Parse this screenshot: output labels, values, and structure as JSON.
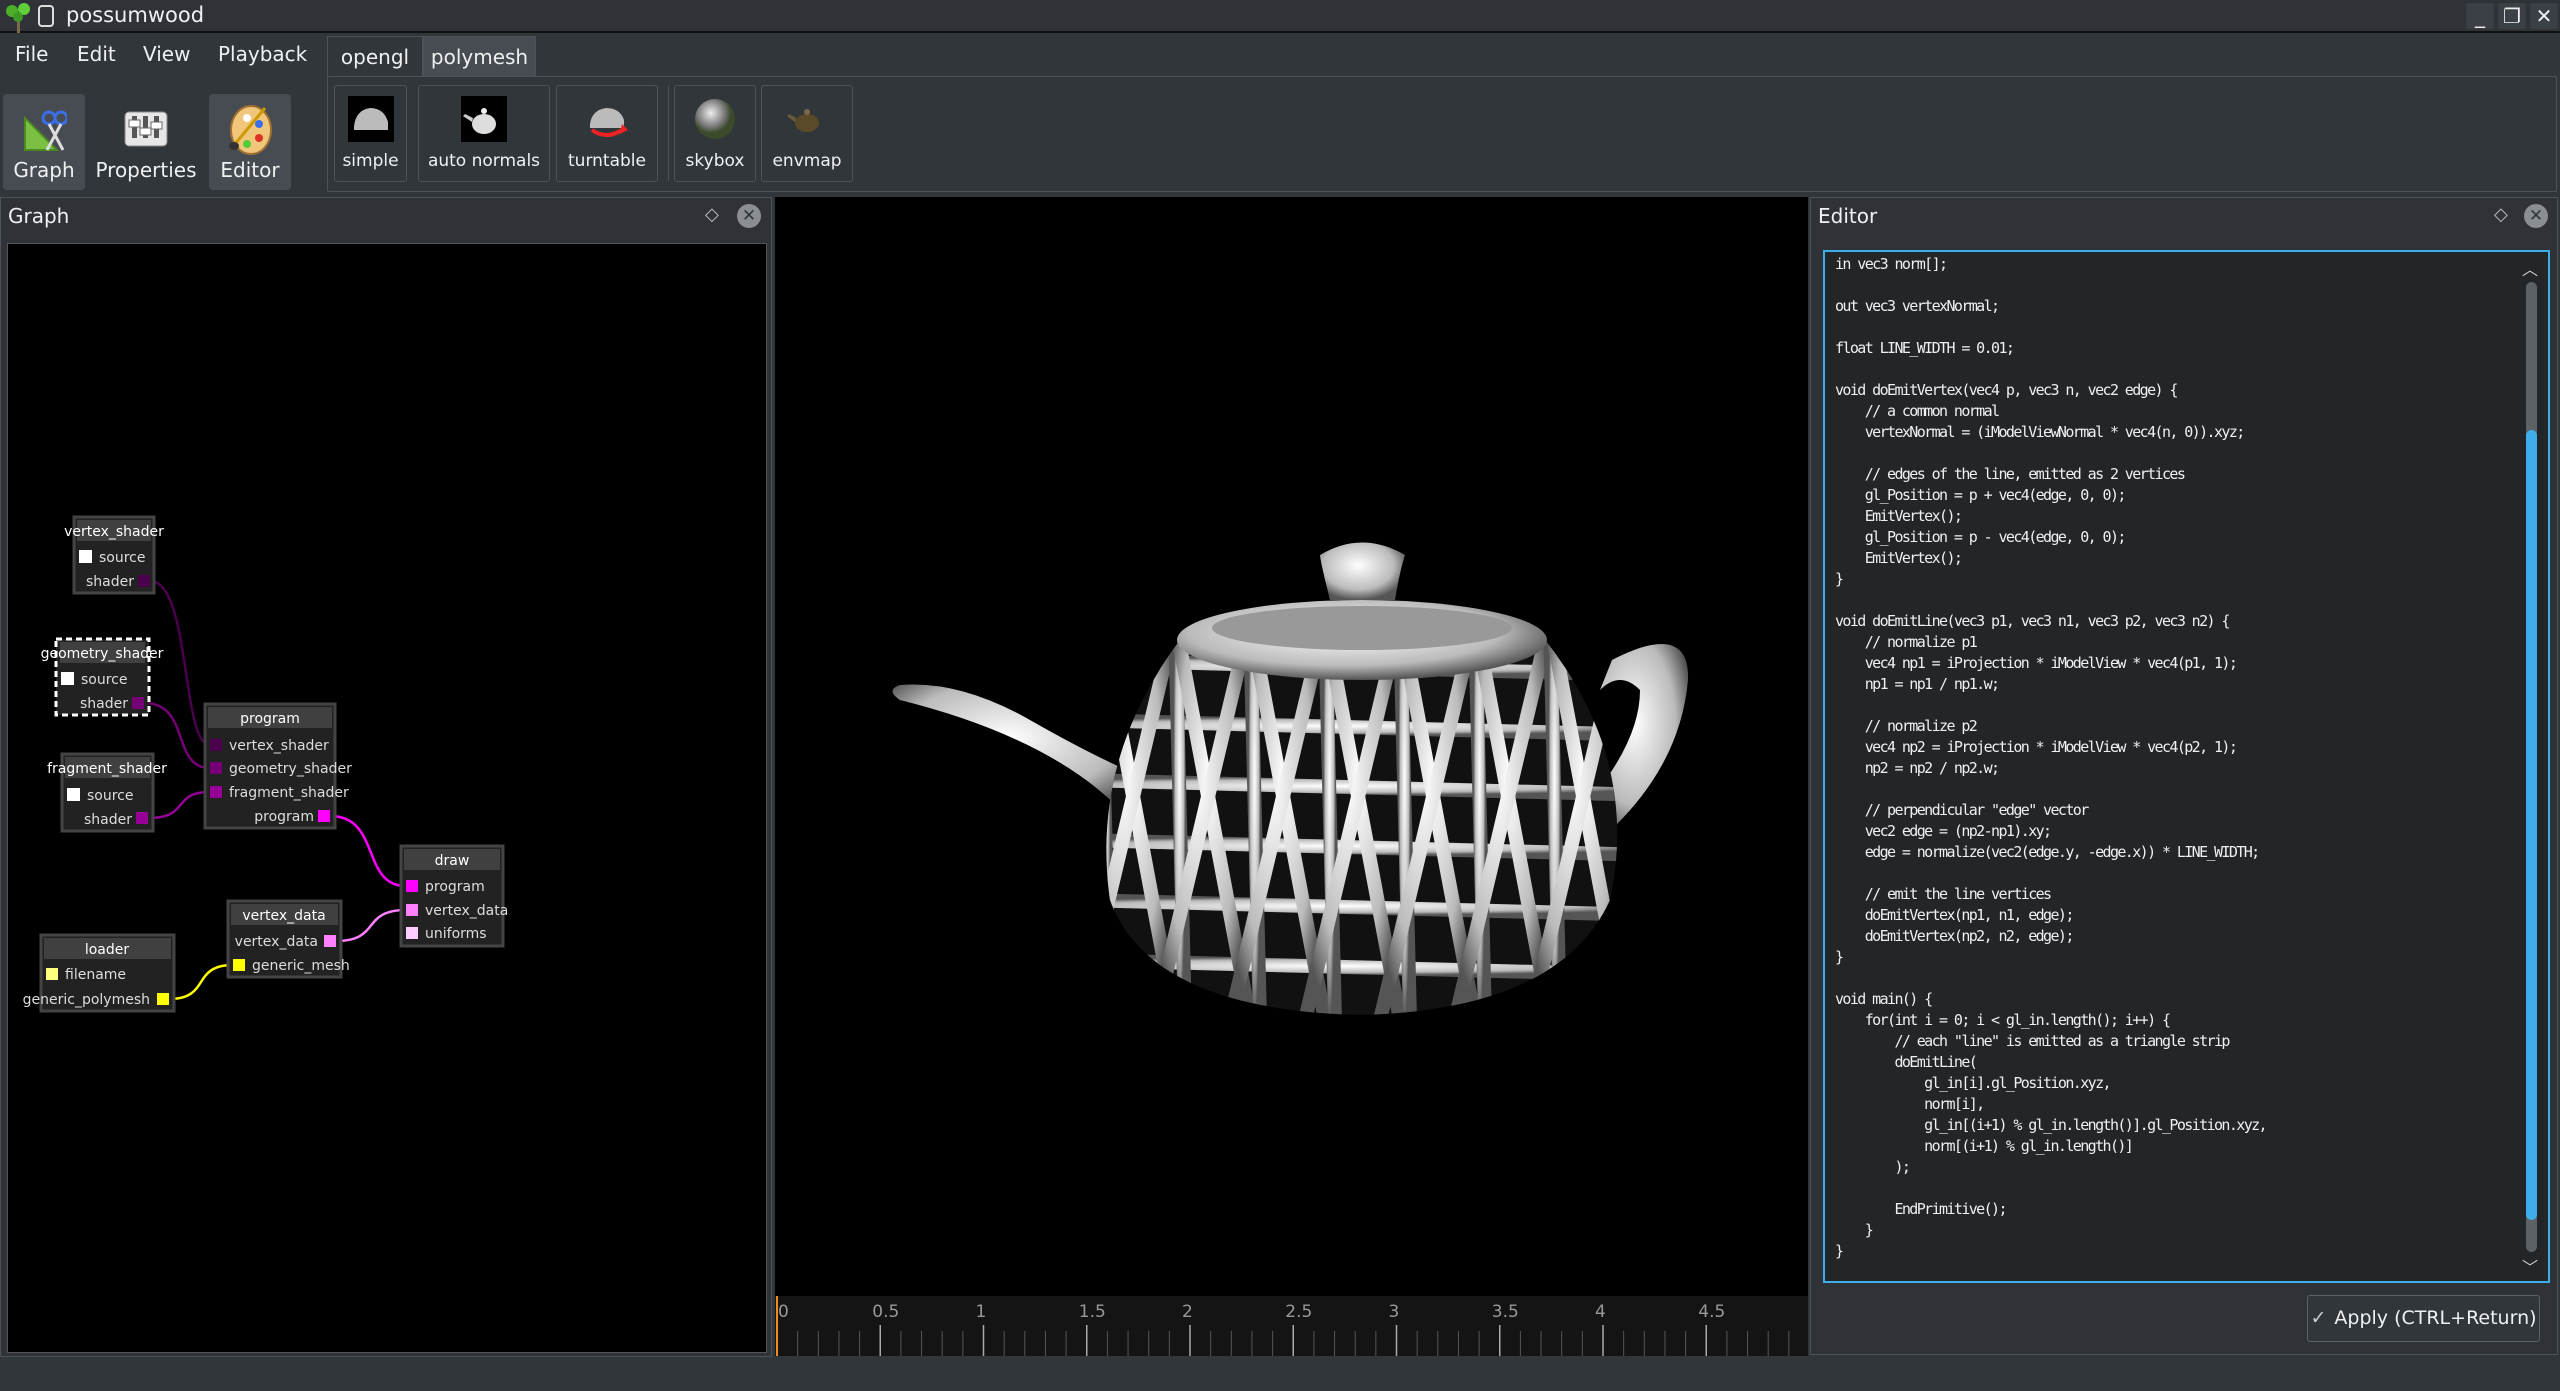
{
  "window": {
    "title": "possumwood",
    "controls": {
      "minimize": "_",
      "restore": "❐",
      "close": "✕"
    }
  },
  "menu": [
    "File",
    "Edit",
    "View",
    "Playback"
  ],
  "left_toolbar": [
    {
      "label": "Graph",
      "icon": "graph-tools-icon",
      "active": true
    },
    {
      "label": "Properties",
      "icon": "properties-sliders-icon",
      "active": false
    },
    {
      "label": "Editor",
      "icon": "palette-icon",
      "active": true
    }
  ],
  "tabs": [
    {
      "label": "opengl",
      "selected": false
    },
    {
      "label": "polymesh",
      "selected": true
    }
  ],
  "tool_buttons": [
    {
      "label": "simple"
    },
    {
      "label": "auto normals"
    },
    {
      "label": "turntable"
    },
    {
      "label": "skybox"
    },
    {
      "label": "envmap"
    }
  ],
  "graph_dock": {
    "title": "Graph",
    "float_icon": "◇",
    "close_icon": "✕"
  },
  "editor_dock": {
    "title": "Editor",
    "float_icon": "◇",
    "close_icon": "✕"
  },
  "nodes": {
    "vertex_shader": {
      "title": "vertex_shader",
      "ports": [
        "source",
        "shader"
      ]
    },
    "geometry_shader": {
      "title": "geometry_shader",
      "ports": [
        "source",
        "shader"
      ]
    },
    "fragment_shader": {
      "title": "fragment_shader",
      "ports": [
        "source",
        "shader"
      ]
    },
    "program": {
      "title": "program",
      "ports": [
        "vertex_shader",
        "geometry_shader",
        "fragment_shader",
        "program"
      ]
    },
    "draw": {
      "title": "draw",
      "ports": [
        "program",
        "vertex_data",
        "uniforms"
      ]
    },
    "vertex_data": {
      "title": "vertex_data",
      "ports": [
        "vertex_data",
        "generic_mesh"
      ]
    },
    "loader": {
      "title": "loader",
      "ports": [
        "filename",
        "generic_polymesh"
      ]
    }
  },
  "port_colors": {
    "source": "#ffffff",
    "vertex_shader": "#4b004b",
    "geometry_shader": "#750075",
    "fragment_shader": "#960096",
    "program": "#ff00ff",
    "vertex_data": "#ff80ff",
    "uniforms": "#ffccff",
    "generic_mesh": "#ffff00",
    "filename": "#ffff80"
  },
  "timeline": {
    "ticks": [
      "0",
      "0.5",
      "1",
      "1.5",
      "2",
      "2.5",
      "3",
      "3.5",
      "4",
      "4.5"
    ],
    "current": 0,
    "accent": "#f08c1e"
  },
  "editor": {
    "code": "in vec3 norm[];\n\nout vec3 vertexNormal;\n\nfloat LINE_WIDTH = 0.01;\n\nvoid doEmitVertex(vec4 p, vec3 n, vec2 edge) {\n    // a common normal\n    vertexNormal = (iModelViewNormal * vec4(n, 0)).xyz;\n\n    // edges of the line, emitted as 2 vertices\n    gl_Position = p + vec4(edge, 0, 0);\n    EmitVertex();\n    gl_Position = p - vec4(edge, 0, 0);\n    EmitVertex();\n}\n\nvoid doEmitLine(vec3 p1, vec3 n1, vec3 p2, vec3 n2) {\n    // normalize p1\n    vec4 np1 = iProjection * iModelView * vec4(p1, 1);\n    np1 = np1 / np1.w;\n\n    // normalize p2\n    vec4 np2 = iProjection * iModelView * vec4(p2, 1);\n    np2 = np2 / np2.w;\n\n    // perpendicular \"edge\" vector\n    vec2 edge = (np2-np1).xy;\n    edge = normalize(vec2(edge.y, -edge.x)) * LINE_WIDTH;\n\n    // emit the line vertices\n    doEmitVertex(np1, n1, edge);\n    doEmitVertex(np2, n2, edge);\n}\n\nvoid main() {\n    for(int i = 0; i < gl_in.length(); i++) {\n        // each \"line\" is emitted as a triangle strip\n        doEmitLine(\n            gl_in[i].gl_Position.xyz,\n            norm[i],\n            gl_in[(i+1) % gl_in.length()].gl_Position.xyz,\n            norm[(i+1) % gl_in.length()]\n        );\n\n        EndPrimitive();\n    }\n}",
    "apply_label": "Apply (CTRL+Return)",
    "apply_icon": "✓",
    "accent": "#3daee9"
  }
}
